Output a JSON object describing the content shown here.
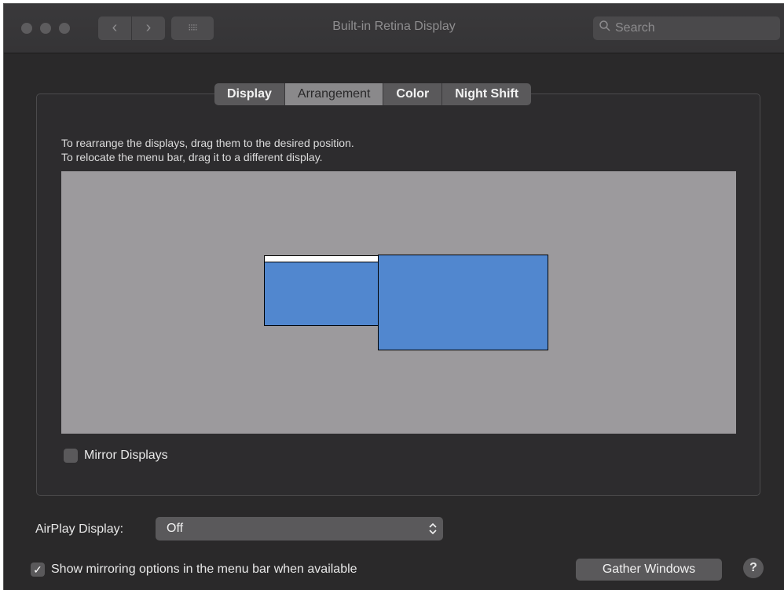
{
  "window": {
    "title": "Built-in Retina Display",
    "grid_glyph": "⁝⁝⁝⁝",
    "back_glyph": "‹",
    "forward_glyph": "›"
  },
  "search": {
    "placeholder": "Search"
  },
  "tabs": [
    {
      "label": "Display",
      "active": false
    },
    {
      "label": "Arrangement",
      "active": true
    },
    {
      "label": "Color",
      "active": false
    },
    {
      "label": "Night Shift",
      "active": false
    }
  ],
  "arrangement": {
    "instruction_line1": "To rearrange the displays, drag them to the desired position.",
    "instruction_line2": "To relocate the menu bar, drag it to a different display.",
    "display_color": "#5187cf",
    "background_color": "#9c9a9d"
  },
  "mirror": {
    "label": "Mirror Displays",
    "checked": false
  },
  "airplay": {
    "label": "AirPlay Display:",
    "value": "Off"
  },
  "show_mirroring": {
    "label": "Show mirroring options in the menu bar when available",
    "checked": true,
    "check_glyph": "✓"
  },
  "buttons": {
    "gather_windows": "Gather Windows",
    "help": "?"
  },
  "icons": {
    "close": "traffic-light-close-icon",
    "minimize": "traffic-light-minimize-icon",
    "zoom": "traffic-light-zoom-icon",
    "back": "chevron-left-icon",
    "forward": "chevron-right-icon",
    "show_all": "grid-icon",
    "search": "magnifier-icon",
    "popup_arrows": "updown-chevron-icon"
  }
}
